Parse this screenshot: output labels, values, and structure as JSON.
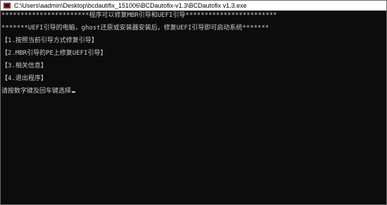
{
  "window": {
    "title": "C:\\Users\\aadmin\\Desktop\\bcdautifix_151006\\BCDautofix-v1.3\\BCDautofix v1.3.exe"
  },
  "console": {
    "lines": [
      "***********************程序可以修复MBR引导和UEFI引导************************",
      "*******UEFI引导的电脑，ghost还原或安装器安装后，修复UEFI引导即可启动系统*******",
      "【1.按照当前引导方式修复引导】",
      "【2.MBR引导的PE上修复UEFI引导】",
      "【3.相关信息】",
      "【4.退出程序】",
      "请按数字键及回车键选择"
    ]
  },
  "colors": {
    "console_background": "#0c0c0c",
    "console_text": "#cccccc",
    "titlebar_background": "#ffffff"
  }
}
